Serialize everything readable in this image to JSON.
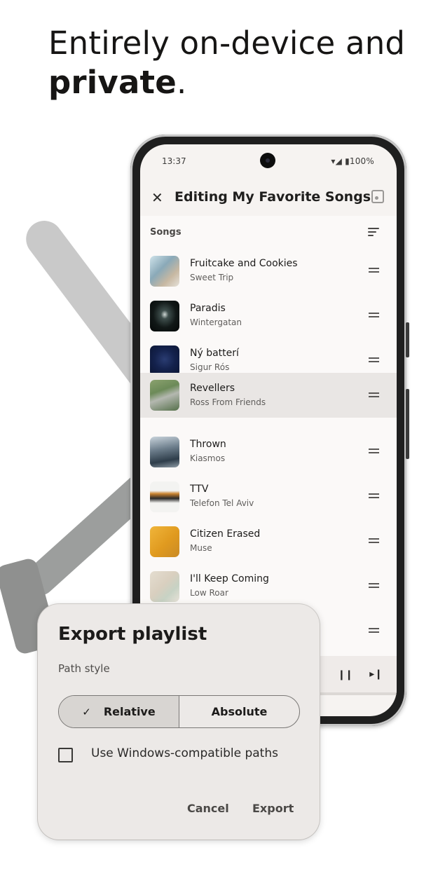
{
  "headline": {
    "regular": "Entirely on-device and",
    "bold": "private",
    "suffix": "."
  },
  "status_bar": {
    "time": "13:37",
    "battery": "100%"
  },
  "top_bar": {
    "title": "Editing My Favorite Songs"
  },
  "section": {
    "label": "Songs"
  },
  "songs": [
    {
      "title": "Fruitcake and Cookies",
      "artist": "Sweet Trip"
    },
    {
      "title": "Paradis",
      "artist": "Wintergatan"
    },
    {
      "title": "Ný batterí",
      "artist": "Sigur Rós"
    },
    {
      "title": "Revellers",
      "artist": "Ross From Friends"
    },
    {
      "title": "Thrown",
      "artist": "Kiasmos"
    },
    {
      "title": "TTV",
      "artist": "Telefon Tel Aviv"
    },
    {
      "title": "Citizen Erased",
      "artist": "Muse"
    },
    {
      "title": "I'll Keep Coming",
      "artist": "Low Roar"
    }
  ],
  "dialog": {
    "title": "Export playlist",
    "subtitle": "Path style",
    "segments": {
      "relative": "Relative",
      "absolute": "Absolute",
      "selected": "Relative"
    },
    "checkbox_label": "Use Windows-compatible paths",
    "checkbox_checked": false,
    "cancel_label": "Cancel",
    "export_label": "Export"
  }
}
